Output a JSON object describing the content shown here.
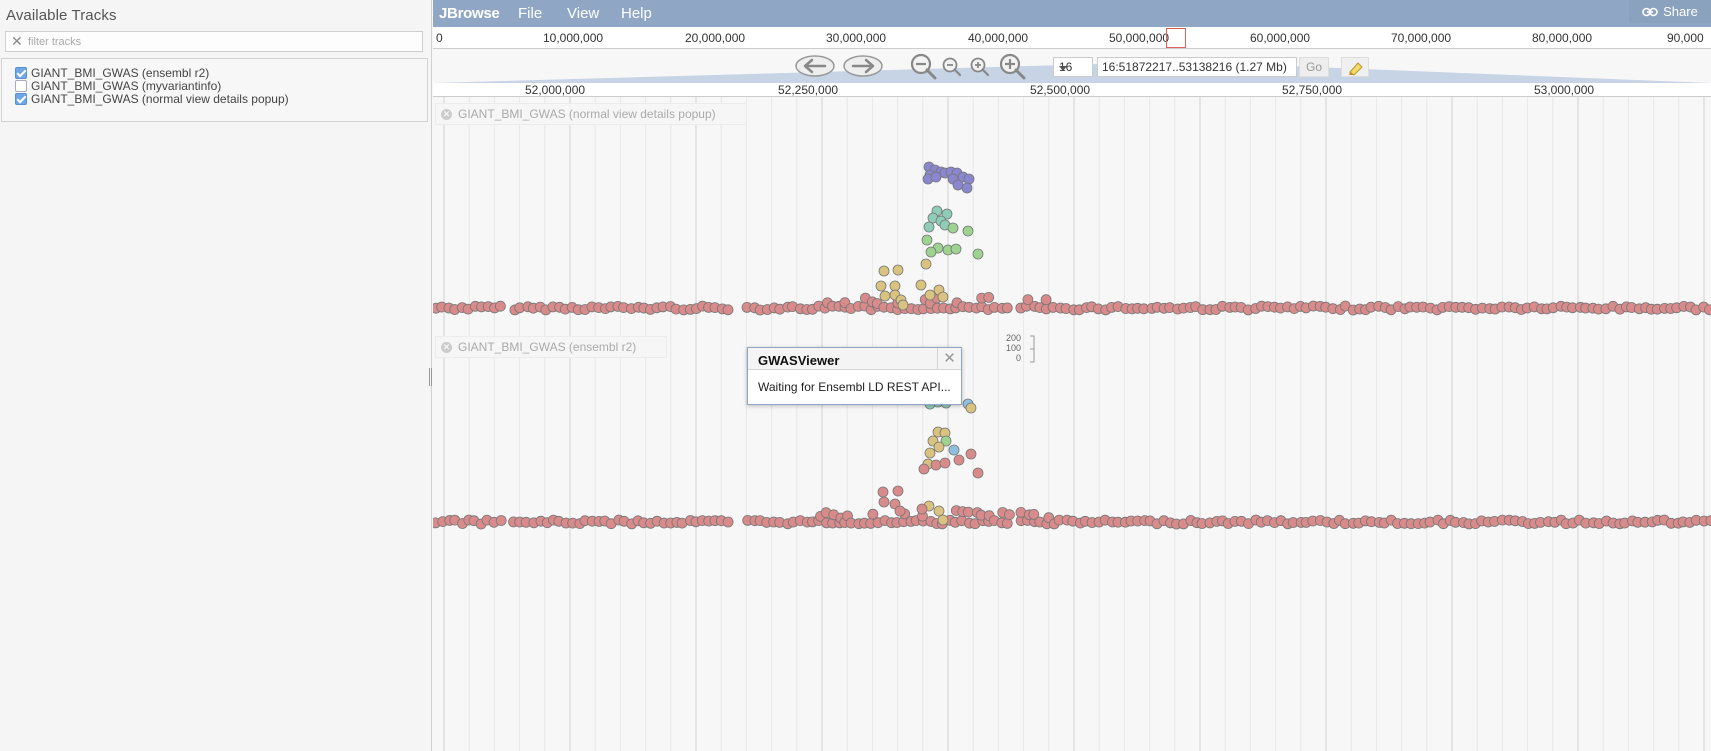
{
  "left_panel": {
    "title": "Available Tracks",
    "filter_placeholder": "filter tracks",
    "tracks": [
      {
        "label": "GIANT_BMI_GWAS (ensembl r2)",
        "checked": true
      },
      {
        "label": "GIANT_BMI_GWAS (myvariantinfo)",
        "checked": false
      },
      {
        "label": "GIANT_BMI_GWAS (normal view details popup)",
        "checked": true
      }
    ]
  },
  "menubar": {
    "logo": "JBrowse",
    "items": [
      "File",
      "View",
      "Help"
    ],
    "share_label": "Share",
    "share_icon": "link-icon"
  },
  "overview": {
    "labels": [
      "0",
      "10,000,000",
      "20,000,000",
      "30,000,000",
      "40,000,000",
      "50,000,000",
      "60,000,000",
      "70,000,000",
      "80,000,000",
      "90,000"
    ]
  },
  "navbar": {
    "chromosome": "16",
    "location": "16:51872217..53138216 (1.27 Mb)",
    "go_label": "Go",
    "icons": [
      "pan-left-icon",
      "pan-right-icon",
      "zoom-out-big-icon",
      "zoom-out-icon",
      "zoom-in-icon",
      "zoom-in-big-icon",
      "highlight-icon"
    ]
  },
  "detail_ruler": {
    "labels": [
      "52,000,000",
      "52,250,000",
      "52,500,000",
      "52,750,000",
      "53,000,000"
    ]
  },
  "tracks": [
    {
      "label": "GIANT_BMI_GWAS (normal view details popup)"
    },
    {
      "label": "GIANT_BMI_GWAS (ensembl r2)"
    }
  ],
  "yscale": {
    "labels": [
      "200",
      "100",
      "0"
    ]
  },
  "dialog": {
    "title": "GWASViewer",
    "body": "Waiting for Ensembl LD REST API..."
  },
  "colors": {
    "menubar": "#8fa7c4",
    "dot_baseline": "#d98a8a",
    "dot_purple": "#8a86cf",
    "dot_teal": "#8ecdb8",
    "dot_green": "#9dd38e",
    "dot_tan": "#d9c37f",
    "dot_blue": "#8fc0e0"
  }
}
